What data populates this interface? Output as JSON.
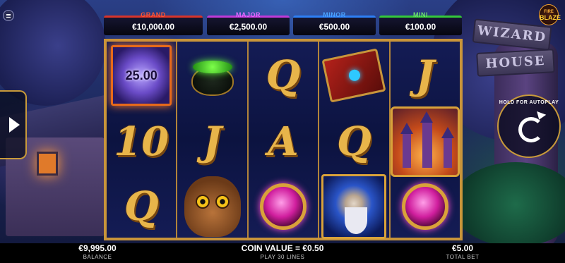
{
  "jackpots": {
    "grand": {
      "label": "GRAND",
      "value": "€10,000.00"
    },
    "major": {
      "label": "MAJOR",
      "value": "€2,500.00"
    },
    "minor": {
      "label": "MINOR",
      "value": "€500.00"
    },
    "mini": {
      "label": "MINI",
      "value": "€100.00"
    }
  },
  "scenery": {
    "sign_top": "WIZARD",
    "sign_bottom": "HOUSE"
  },
  "logo": {
    "line1": "FIRE",
    "line2": "BLAZE"
  },
  "autoplay": {
    "label": "HOLD FOR AUTOPLAY"
  },
  "reels": [
    [
      {
        "symbol": "orb",
        "value": "25.00"
      },
      {
        "symbol": "10",
        "text": "10"
      },
      {
        "symbol": "Q",
        "text": "Q"
      }
    ],
    [
      {
        "symbol": "cauldron"
      },
      {
        "symbol": "J",
        "text": "J"
      },
      {
        "symbol": "owl"
      }
    ],
    [
      {
        "symbol": "Q",
        "text": "Q"
      },
      {
        "symbol": "A",
        "text": "A"
      },
      {
        "symbol": "ring"
      }
    ],
    [
      {
        "symbol": "spellbook"
      },
      {
        "symbol": "Q",
        "text": "Q"
      },
      {
        "symbol": "wizard"
      }
    ],
    [
      {
        "symbol": "J",
        "text": "J"
      },
      {
        "symbol": "castle"
      },
      {
        "symbol": "ring"
      }
    ]
  ],
  "bottom_bar": {
    "balance_value": "€9,995.00",
    "balance_label": "BALANCE",
    "coin_value": "COIN VALUE = €0.50",
    "lines": "PLAY 30 LINES",
    "total_bet_value": "€5.00",
    "total_bet_label": "TOTAL BET"
  },
  "colors": {
    "grand": "#d8342a",
    "major": "#c03ad8",
    "minor": "#2d7ff5",
    "mini": "#34c93a",
    "frame_gold": "#c9953a"
  }
}
